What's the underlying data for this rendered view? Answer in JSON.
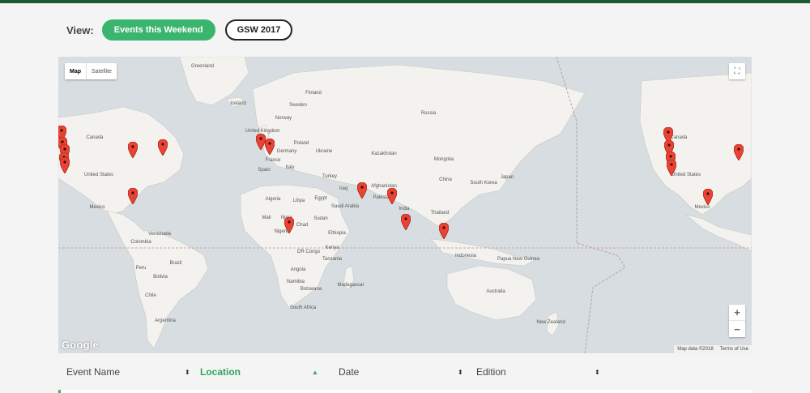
{
  "view": {
    "label": "View:",
    "buttons": [
      {
        "label": "Events this Weekend",
        "active": true
      },
      {
        "label": "GSW 2017",
        "active": false
      }
    ]
  },
  "map": {
    "type_controls": [
      "Map",
      "Satellite"
    ],
    "fullscreen_icon": "fullscreen-icon",
    "zoom_in": "+",
    "zoom_out": "−",
    "logo": "Google",
    "attribution": [
      "Map data ©2018",
      "Terms of Use"
    ],
    "colors": {
      "water": "#d7dde0",
      "land": "#f3f2ee",
      "pin": "#ea4335",
      "dateline": "#b9a0a0"
    },
    "labels": [
      "Greenland",
      "Iceland",
      "Finland",
      "Sweden",
      "Norway",
      "Russia",
      "United Kingdom",
      "Germany",
      "Poland",
      "Ukraine",
      "France",
      "Spain",
      "Italy",
      "Kazakhstan",
      "Mongolia",
      "China",
      "South Korea",
      "Japan",
      "Turkey",
      "Iraq",
      "Afghanistan",
      "Pakistan",
      "India",
      "Thailand",
      "Algeria",
      "Libya",
      "Egypt",
      "Saudi Arabia",
      "Mali",
      "Niger",
      "Chad",
      "Sudan",
      "Nigeria",
      "Ethiopia",
      "Kenya",
      "DR Congo",
      "Tanzania",
      "Angola",
      "Namibia",
      "Botswana",
      "Madagascar",
      "South Africa",
      "Indonesia",
      "Papua New Guinea",
      "Australia",
      "New Zealand",
      "Canada",
      "United States",
      "Mexico",
      "Venezuela",
      "Colombia",
      "Peru",
      "Brazil",
      "Bolivia",
      "Chile",
      "Argentina"
    ]
  },
  "table": {
    "columns": [
      {
        "label": "Event Name",
        "active": false
      },
      {
        "label": "Location",
        "active": true
      },
      {
        "label": "Date",
        "active": false
      },
      {
        "label": "Edition",
        "active": false
      }
    ],
    "sort_icon": "sort-icon"
  }
}
